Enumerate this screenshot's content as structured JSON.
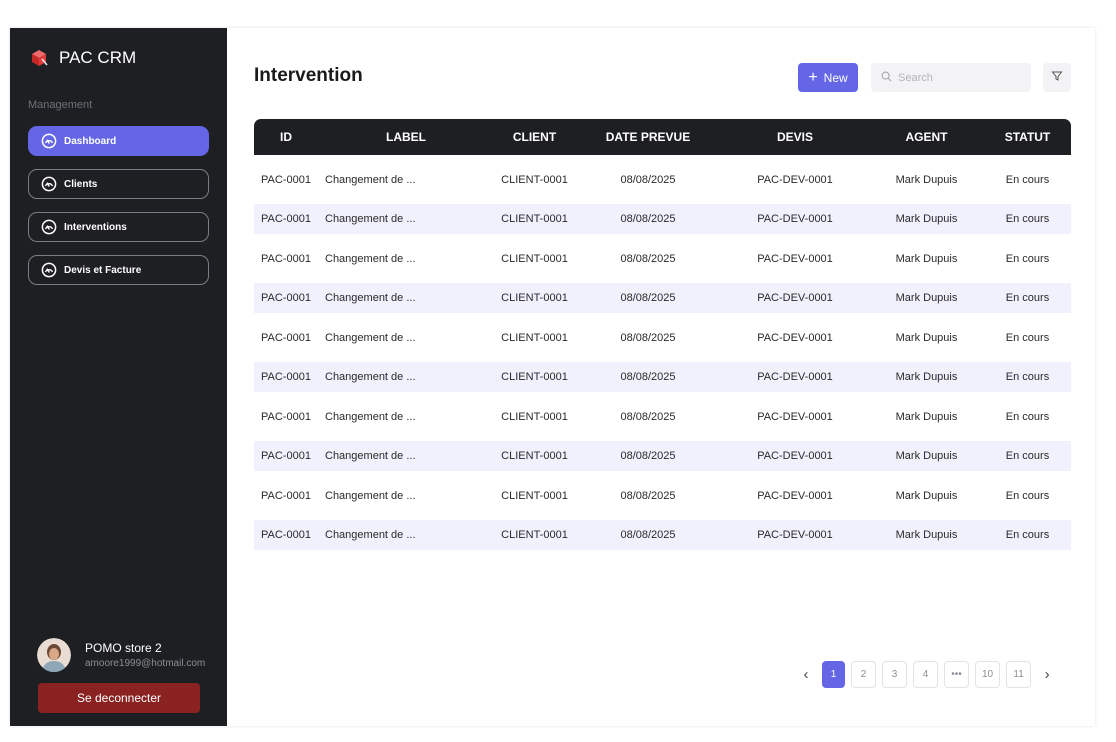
{
  "app": {
    "name": "PAC CRM"
  },
  "sidebar": {
    "section_label": "Management",
    "items": [
      {
        "label": "Dashboard",
        "active": true
      },
      {
        "label": "Clients"
      },
      {
        "label": "Interventions"
      },
      {
        "label": "Devis et Facture"
      }
    ],
    "user": {
      "name": "POMO store 2",
      "email": "amoore1999@hotmail.com"
    },
    "logout_label": "Se deconnecter"
  },
  "header": {
    "title": "Intervention",
    "new_label": "New",
    "search_placeholder": "Search"
  },
  "table": {
    "columns": [
      "ID",
      "LABEL",
      "CLIENT",
      "DATE PREVUE",
      "DEVIS",
      "AGENT",
      "STATUT"
    ],
    "rows": [
      [
        "PAC-0001",
        "Changement de ...",
        "CLIENT-0001",
        "08/08/2025",
        "PAC-DEV-0001",
        "Mark Dupuis",
        "En cours"
      ],
      [
        "PAC-0001",
        "Changement de ...",
        "CLIENT-0001",
        "08/08/2025",
        "PAC-DEV-0001",
        "Mark Dupuis",
        "En cours"
      ],
      [
        "PAC-0001",
        "Changement de ...",
        "CLIENT-0001",
        "08/08/2025",
        "PAC-DEV-0001",
        "Mark Dupuis",
        "En cours"
      ],
      [
        "PAC-0001",
        "Changement de ...",
        "CLIENT-0001",
        "08/08/2025",
        "PAC-DEV-0001",
        "Mark Dupuis",
        "En cours"
      ],
      [
        "PAC-0001",
        "Changement de ...",
        "CLIENT-0001",
        "08/08/2025",
        "PAC-DEV-0001",
        "Mark Dupuis",
        "En cours"
      ],
      [
        "PAC-0001",
        "Changement de ...",
        "CLIENT-0001",
        "08/08/2025",
        "PAC-DEV-0001",
        "Mark Dupuis",
        "En cours"
      ],
      [
        "PAC-0001",
        "Changement de ...",
        "CLIENT-0001",
        "08/08/2025",
        "PAC-DEV-0001",
        "Mark Dupuis",
        "En cours"
      ],
      [
        "PAC-0001",
        "Changement de ...",
        "CLIENT-0001",
        "08/08/2025",
        "PAC-DEV-0001",
        "Mark Dupuis",
        "En cours"
      ],
      [
        "PAC-0001",
        "Changement de ...",
        "CLIENT-0001",
        "08/08/2025",
        "PAC-DEV-0001",
        "Mark Dupuis",
        "En cours"
      ],
      [
        "PAC-0001",
        "Changement de ...",
        "CLIENT-0001",
        "08/08/2025",
        "PAC-DEV-0001",
        "Mark Dupuis",
        "En cours"
      ]
    ]
  },
  "pagination": {
    "pages": [
      "1",
      "2",
      "3",
      "4",
      "•••",
      "10",
      "11"
    ],
    "current": "1"
  },
  "colors": {
    "accent": "#6466e6",
    "sidebar_bg": "#1e1f22",
    "logout_bg": "#8a2222",
    "row_highlight": "#f1f1fd"
  },
  "icons": {
    "brand": "red-cube-logo-icon",
    "nav": "gauge-icon",
    "search": "search-icon",
    "filter": "filter-icon",
    "prev": "chevron-left-icon",
    "next": "chevron-right-icon"
  }
}
